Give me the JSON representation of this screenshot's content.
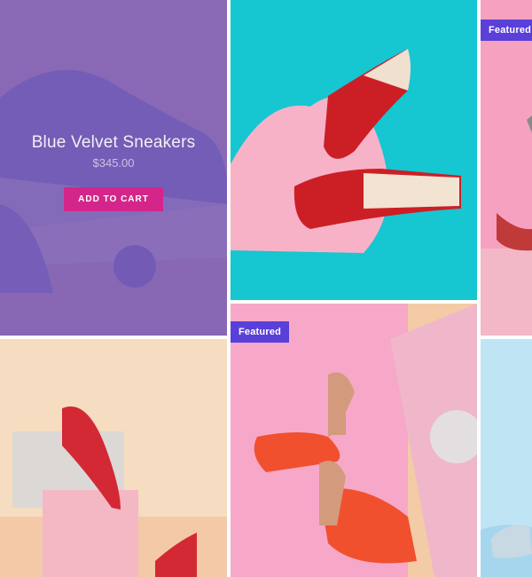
{
  "grid": {
    "hovered_product": {
      "title": "Blue Velvet Sneakers",
      "price": "$345.00",
      "cta": "ADD TO CART"
    },
    "badges": {
      "featured_1": "Featured",
      "featured_2": "Featured"
    }
  },
  "colors": {
    "overlay": "#7a5cb2",
    "cart_button": "#d4268a",
    "badge": "#5a3fd9",
    "teal_bg": "#16c6d1",
    "pink_bg": "#f7a1c0",
    "peach_bg": "#f6dcc0",
    "light_blue_bg": "#bfe5f5"
  },
  "icons": {
    "sneaker": "blue-sneaker-illustration",
    "red_mules": "red-mule-shoes",
    "heels": "nude-orange-heels",
    "slingbacks": "red-slingback-shoes"
  }
}
